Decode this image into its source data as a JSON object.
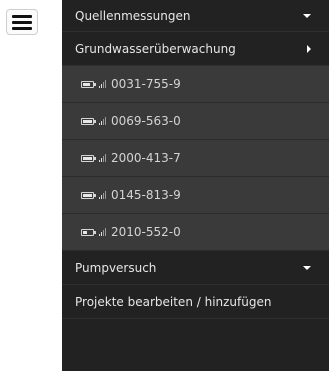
{
  "menu": {
    "items": [
      {
        "label": "Quellenmessungen",
        "caret": "down"
      },
      {
        "label": "Grundwasserüberwachung",
        "caret": "right"
      }
    ],
    "wells": [
      {
        "id": "0031-755-9",
        "battery": 0.75,
        "signal": 2
      },
      {
        "id": "0069-563-0",
        "battery": 0.95,
        "signal": 2
      },
      {
        "id": "2000-413-7",
        "battery": 0.95,
        "signal": 2
      },
      {
        "id": "0145-813-9",
        "battery": 0.95,
        "signal": 2
      },
      {
        "id": "2010-552-0",
        "battery": 0.4,
        "signal": 2
      }
    ],
    "bottom": [
      {
        "label": "Pumpversuch",
        "caret": "down"
      },
      {
        "label": "Projekte bearbeiten / hinzufügen",
        "caret": ""
      }
    ]
  }
}
